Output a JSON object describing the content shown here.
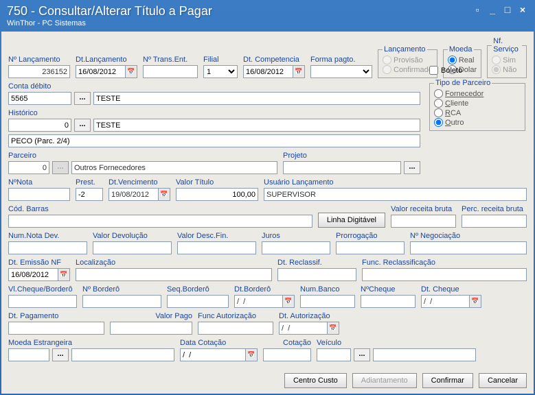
{
  "title": "750 - Consultar/Alterar Título a Pagar",
  "subtitle": "WinThor - PC Sistemas",
  "labels": {
    "nlanc": "Nº Lançamento",
    "dtlanc": "Dt.Lançamento",
    "ntrans": "Nº Trans.Ent.",
    "filial": "Filial",
    "dtcomp": "Dt. Competencia",
    "formapag": "Forma pagto.",
    "lancamento": "Lançamento",
    "moeda": "Moeda",
    "nfservico": "Nf. Serviço",
    "conta": "Conta débito",
    "historico": "Histórico",
    "boleto": "Boleto",
    "tipoparc": "Tipo de Parceiro",
    "parceiro": "Parceiro",
    "projeto": "Projeto",
    "nnota": "NºNota",
    "prest": "Prest.",
    "dtvenc": "Dt.Vencimento",
    "valortit": "Valor Título",
    "usuario": "Usuário Lançamento",
    "codbarras": "Cód. Barras",
    "linhadig": "Linha Digitável",
    "vrb": "Valor receita bruta",
    "prb": "Perc. receita bruta",
    "nnd": "Num.Nota Dev.",
    "vdev": "Valor Devolução",
    "vdf": "Valor Desc.Fin.",
    "juros": "Juros",
    "prorr": "Prorrogação",
    "nneg": "Nº Negociação",
    "dtemnf": "Dt. Emissão NF",
    "loc": "Localização",
    "dtrecl": "Dt. Reclassif.",
    "funcrecl": "Func. Reclassificação",
    "vcb": "Vl.Cheque/Borderô",
    "nbord": "Nº Borderô",
    "sbord": "Seq.Borderô",
    "dtbord": "Dt.Borderô",
    "numbanco": "Num.Banco",
    "ncheque": "NºCheque",
    "dtcheque": "Dt. Cheque",
    "dtpag": "Dt. Pagamento",
    "vpago": "Valor Pago",
    "funcaut": "Func Autorização",
    "dtaut": "Dt. Autorização",
    "moedaest": "Moeda Estrangeira",
    "dtcot": "Data Cotação",
    "cotacao": "Cotação",
    "veiculo": "Veículo"
  },
  "values": {
    "nlanc": "236152",
    "dtlanc": "16/08/2012",
    "ntrans": "",
    "filial": "1",
    "dtcomp": "16/08/2012",
    "conta": "5565",
    "contadesc": "TESTE",
    "historico": "0",
    "histdesc": "TESTE",
    "histline2": "PECO (Parc. 2/4)",
    "parceiro": "0",
    "parcdesc": "Outros Fornecedores",
    "nnota": "",
    "prest": "-2",
    "dtvenc": "19/08/2012",
    "valortit": "100,00",
    "usuario": "SUPERVISOR",
    "dtemnf": "16/08/2012",
    "dtbord": "/  /",
    "dtcheque": "/  /",
    "dtaut": "/  /",
    "dtcot": "/  /"
  },
  "options": {
    "lanc1": "Provisão",
    "lanc2": "Confirmado",
    "moeda1": "Real",
    "moeda2": "Dolar",
    "nf1": "Sim",
    "nf2": "Não",
    "tp1": "Fornecedor",
    "tp2": "Cliente",
    "tp3": "RCA",
    "tp4": "Outro"
  },
  "buttons": {
    "centro": "Centro Custo",
    "adiant": "Adiantamento",
    "confirmar": "Confirmar",
    "cancelar": "Cancelar"
  }
}
